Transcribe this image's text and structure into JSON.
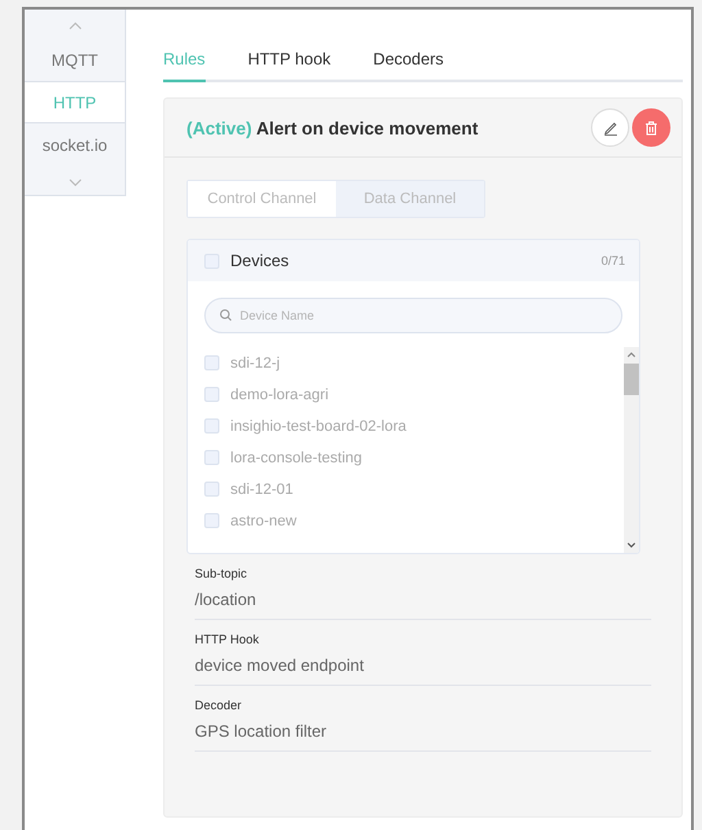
{
  "sidebar": {
    "items": [
      {
        "label": "MQTT",
        "selected": false
      },
      {
        "label": "HTTP",
        "selected": true
      },
      {
        "label": "socket.io",
        "selected": false
      }
    ]
  },
  "tabs": [
    {
      "label": "Rules",
      "selected": true
    },
    {
      "label": "HTTP hook",
      "selected": false
    },
    {
      "label": "Decoders",
      "selected": false
    }
  ],
  "rule": {
    "status": "(Active)",
    "title": "Alert on device movement",
    "channel_tabs": [
      {
        "label": "Control Channel",
        "selected": true
      },
      {
        "label": "Data Channel",
        "selected": false
      }
    ],
    "devices": {
      "title": "Devices",
      "checked": false,
      "count": "0/71",
      "search": {
        "placeholder": "Device Name"
      },
      "items": [
        {
          "label": "sdi-12-j",
          "checked": false
        },
        {
          "label": "demo-lora-agri",
          "checked": false
        },
        {
          "label": "insighio-test-board-02-lora",
          "checked": false
        },
        {
          "label": "lora-console-testing",
          "checked": false
        },
        {
          "label": "sdi-12-01",
          "checked": false
        },
        {
          "label": "astro-new",
          "checked": false
        }
      ]
    },
    "fields": [
      {
        "label": "Sub-topic",
        "value": "/location"
      },
      {
        "label": "HTTP Hook",
        "value": "device moved endpoint"
      },
      {
        "label": "Decoder",
        "value": "GPS location filter"
      }
    ]
  }
}
